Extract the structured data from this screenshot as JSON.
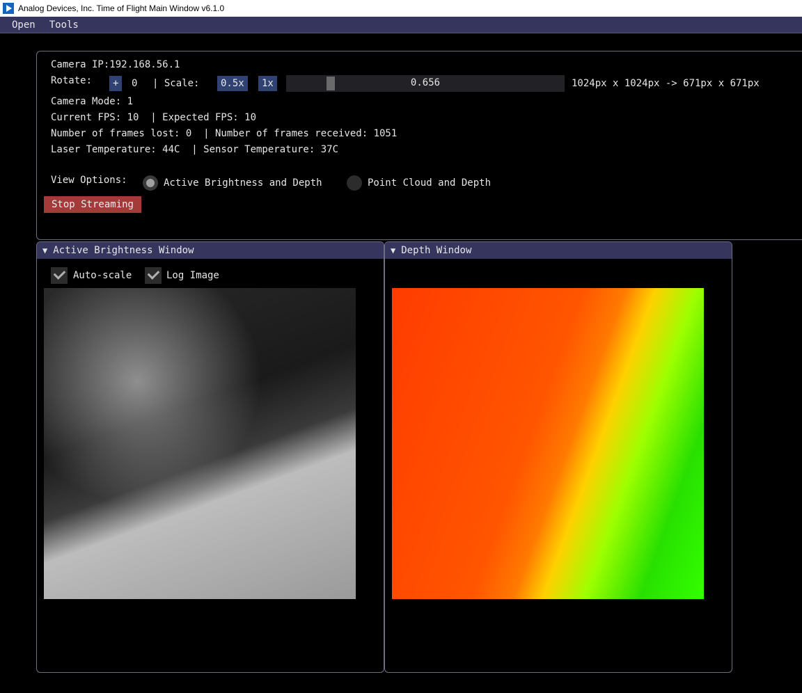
{
  "window": {
    "title": "Analog Devices, Inc. Time of Flight Main Window v6.1.0"
  },
  "menu": {
    "items": [
      "Open",
      "Tools"
    ]
  },
  "panel": {
    "camera_ip": "Camera IP:192.168.56.1",
    "rotate_label": "Rotate:",
    "rotate_plus": "+",
    "rotate_value": "0",
    "scale_label": "| Scale:",
    "scale_btn_half": "0.5x",
    "scale_btn_one": "1x",
    "scale_value": "0.656",
    "scale_fraction": 0.656,
    "resolution": "1024px x 1024px -> 671px x 671px",
    "camera_mode": "Camera Mode: 1",
    "fps": "Current FPS: 10  | Expected FPS: 10",
    "frames": "Number of frames lost: 0  | Number of frames received: 1051",
    "temps": "Laser Temperature: 44C  | Sensor Temperature: 37C",
    "view_options_label": "View Options:",
    "view_option_1": "Active Brightness and Depth",
    "view_option_2": "Point Cloud and Depth",
    "stop_button": "Stop Streaming"
  },
  "brightness_window": {
    "title": "Active Brightness Window",
    "autoscale_label": "Auto-scale",
    "log_image_label": "Log Image"
  },
  "depth_window": {
    "title": "Depth Window"
  },
  "colors": {
    "accent": "#35355e",
    "button_blue": "#2f4272",
    "stop_red": "#a33b3b"
  }
}
